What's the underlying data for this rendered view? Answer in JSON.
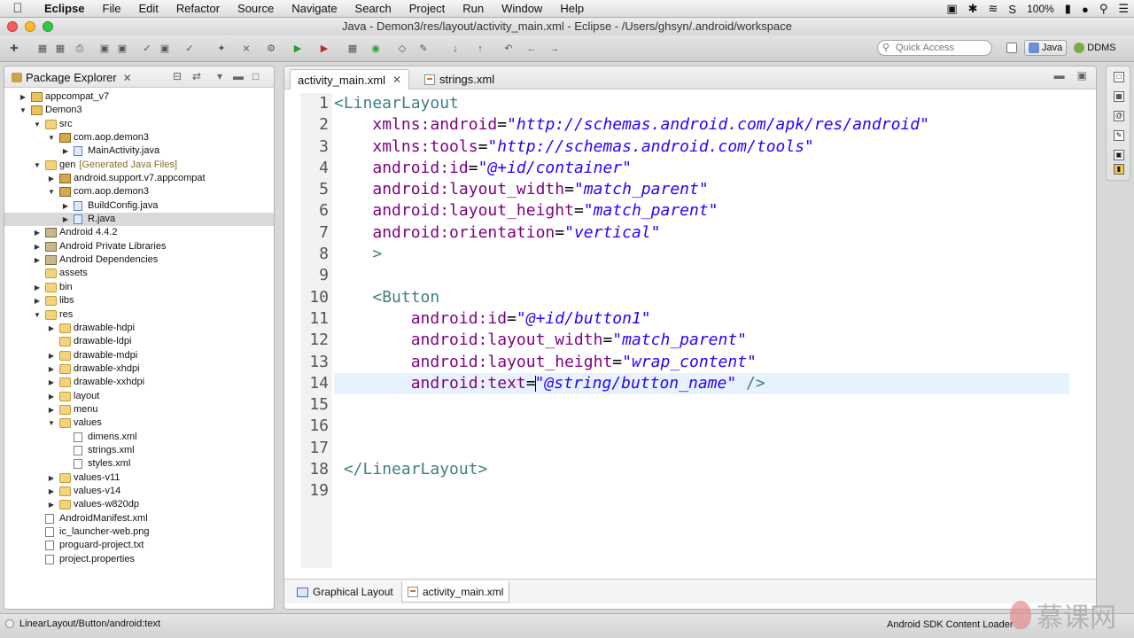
{
  "menubar": {
    "app_name": "Eclipse",
    "items": [
      "File",
      "Edit",
      "Refactor",
      "Source",
      "Navigate",
      "Search",
      "Project",
      "Run",
      "Window",
      "Help"
    ],
    "battery": "100%"
  },
  "window": {
    "title": "Java - Demon3/res/layout/activity_main.xml - Eclipse - /Users/ghsyn/.android/workspace"
  },
  "toolbar": {
    "quick_access_placeholder": "Quick Access",
    "perspectives": [
      "Java",
      "DDMS"
    ]
  },
  "package_explorer": {
    "title": "Package Explorer",
    "tree": [
      {
        "label": "appcompat_v7",
        "depth": 0,
        "twisty": "collapsed",
        "icon": "project"
      },
      {
        "label": "Demon3",
        "depth": 0,
        "twisty": "expanded",
        "icon": "project"
      },
      {
        "label": "src",
        "depth": 1,
        "twisty": "expanded",
        "icon": "folder"
      },
      {
        "label": "com.aop.demon3",
        "depth": 2,
        "twisty": "expanded",
        "icon": "package"
      },
      {
        "label": "MainActivity.java",
        "depth": 3,
        "twisty": "collapsed",
        "icon": "java"
      },
      {
        "label": "gen",
        "decoration": "[Generated Java Files]",
        "depth": 1,
        "twisty": "expanded",
        "icon": "folder"
      },
      {
        "label": "android.support.v7.appcompat",
        "depth": 2,
        "twisty": "collapsed",
        "icon": "package"
      },
      {
        "label": "com.aop.demon3",
        "depth": 2,
        "twisty": "expanded",
        "icon": "package"
      },
      {
        "label": "BuildConfig.java",
        "depth": 3,
        "twisty": "collapsed",
        "icon": "java"
      },
      {
        "label": "R.java",
        "depth": 3,
        "twisty": "collapsed",
        "icon": "java",
        "selected": true
      },
      {
        "label": "Android 4.4.2",
        "depth": 1,
        "twisty": "collapsed",
        "icon": "library"
      },
      {
        "label": "Android Private Libraries",
        "depth": 1,
        "twisty": "collapsed",
        "icon": "library"
      },
      {
        "label": "Android Dependencies",
        "depth": 1,
        "twisty": "collapsed",
        "icon": "library"
      },
      {
        "label": "assets",
        "depth": 1,
        "twisty": "none",
        "icon": "folder"
      },
      {
        "label": "bin",
        "depth": 1,
        "twisty": "collapsed",
        "icon": "folder"
      },
      {
        "label": "libs",
        "depth": 1,
        "twisty": "collapsed",
        "icon": "folder"
      },
      {
        "label": "res",
        "depth": 1,
        "twisty": "expanded",
        "icon": "folder"
      },
      {
        "label": "drawable-hdpi",
        "depth": 2,
        "twisty": "collapsed",
        "icon": "folder"
      },
      {
        "label": "drawable-ldpi",
        "depth": 2,
        "twisty": "none",
        "icon": "folder"
      },
      {
        "label": "drawable-mdpi",
        "depth": 2,
        "twisty": "collapsed",
        "icon": "folder"
      },
      {
        "label": "drawable-xhdpi",
        "depth": 2,
        "twisty": "collapsed",
        "icon": "folder"
      },
      {
        "label": "drawable-xxhdpi",
        "depth": 2,
        "twisty": "collapsed",
        "icon": "folder"
      },
      {
        "label": "layout",
        "depth": 2,
        "twisty": "collapsed",
        "icon": "folder"
      },
      {
        "label": "menu",
        "depth": 2,
        "twisty": "collapsed",
        "icon": "folder"
      },
      {
        "label": "values",
        "depth": 2,
        "twisty": "expanded",
        "icon": "folder"
      },
      {
        "label": "dimens.xml",
        "depth": 3,
        "twisty": "none",
        "icon": "file"
      },
      {
        "label": "strings.xml",
        "depth": 3,
        "twisty": "none",
        "icon": "file"
      },
      {
        "label": "styles.xml",
        "depth": 3,
        "twisty": "none",
        "icon": "file"
      },
      {
        "label": "values-v11",
        "depth": 2,
        "twisty": "collapsed",
        "icon": "folder"
      },
      {
        "label": "values-v14",
        "depth": 2,
        "twisty": "collapsed",
        "icon": "folder"
      },
      {
        "label": "values-w820dp",
        "depth": 2,
        "twisty": "collapsed",
        "icon": "folder"
      },
      {
        "label": "AndroidManifest.xml",
        "depth": 1,
        "twisty": "none",
        "icon": "file"
      },
      {
        "label": "ic_launcher-web.png",
        "depth": 1,
        "twisty": "none",
        "icon": "file"
      },
      {
        "label": "proguard-project.txt",
        "depth": 1,
        "twisty": "none",
        "icon": "file"
      },
      {
        "label": "project.properties",
        "depth": 1,
        "twisty": "none",
        "icon": "file"
      }
    ]
  },
  "editor": {
    "tabs": [
      {
        "label": "activity_main.xml",
        "active": true
      },
      {
        "label": "strings.xml",
        "active": false
      }
    ],
    "current_line": 14,
    "lines": [
      [
        [
          "tag",
          "<LinearLayout"
        ]
      ],
      [
        [
          "plain",
          "    "
        ],
        [
          "attr",
          "xmlns:android"
        ],
        [
          "eq",
          "="
        ],
        [
          "val",
          "\"http://schemas.android.com/apk/res/android\""
        ]
      ],
      [
        [
          "plain",
          "    "
        ],
        [
          "attr",
          "xmlns:tools"
        ],
        [
          "eq",
          "="
        ],
        [
          "val",
          "\"http://schemas.android.com/tools\""
        ]
      ],
      [
        [
          "plain",
          "    "
        ],
        [
          "attr",
          "android:id"
        ],
        [
          "eq",
          "="
        ],
        [
          "val",
          "\"@+id/container\""
        ]
      ],
      [
        [
          "plain",
          "    "
        ],
        [
          "attr",
          "android:layout_width"
        ],
        [
          "eq",
          "="
        ],
        [
          "val",
          "\"match_parent\""
        ]
      ],
      [
        [
          "plain",
          "    "
        ],
        [
          "attr",
          "android:layout_height"
        ],
        [
          "eq",
          "="
        ],
        [
          "val",
          "\"match_parent\""
        ]
      ],
      [
        [
          "plain",
          "    "
        ],
        [
          "attr",
          "android:orientation"
        ],
        [
          "eq",
          "="
        ],
        [
          "val",
          "\"vertical\""
        ]
      ],
      [
        [
          "plain",
          "    "
        ],
        [
          "tag",
          ">"
        ]
      ],
      [],
      [
        [
          "plain",
          "    "
        ],
        [
          "tag",
          "<Button"
        ]
      ],
      [
        [
          "plain",
          "        "
        ],
        [
          "attr",
          "android:id"
        ],
        [
          "eq",
          "="
        ],
        [
          "val",
          "\"@+id/button1\""
        ]
      ],
      [
        [
          "plain",
          "        "
        ],
        [
          "attr",
          "android:layout_width"
        ],
        [
          "eq",
          "="
        ],
        [
          "val",
          "\"match_parent\""
        ]
      ],
      [
        [
          "plain",
          "        "
        ],
        [
          "attr",
          "android:layout_height"
        ],
        [
          "eq",
          "="
        ],
        [
          "val",
          "\"wrap_content\""
        ]
      ],
      [
        [
          "plain",
          "        "
        ],
        [
          "attr",
          "android:text"
        ],
        [
          "eq",
          "="
        ],
        [
          "caret",
          ""
        ],
        [
          "val",
          "\"@string/button_name\""
        ],
        [
          "plain",
          " "
        ],
        [
          "tag",
          "/>"
        ]
      ],
      [],
      [],
      [],
      [
        [
          "plain",
          " "
        ],
        [
          "tag",
          "</LinearLayout>"
        ]
      ],
      []
    ],
    "bottom_tabs": [
      {
        "label": "Graphical Layout",
        "active": false
      },
      {
        "label": "activity_main.xml",
        "active": true
      }
    ]
  },
  "statusbar": {
    "path": "LinearLayout/Button/android:text",
    "right": "Android SDK Content Loader"
  },
  "watermark": {
    "text": "慕课网"
  },
  "colors": {
    "tag": "#3f7f7f",
    "attribute": "#7f007f",
    "value": "#2a00ff",
    "current_line": "#e8f2fe"
  }
}
